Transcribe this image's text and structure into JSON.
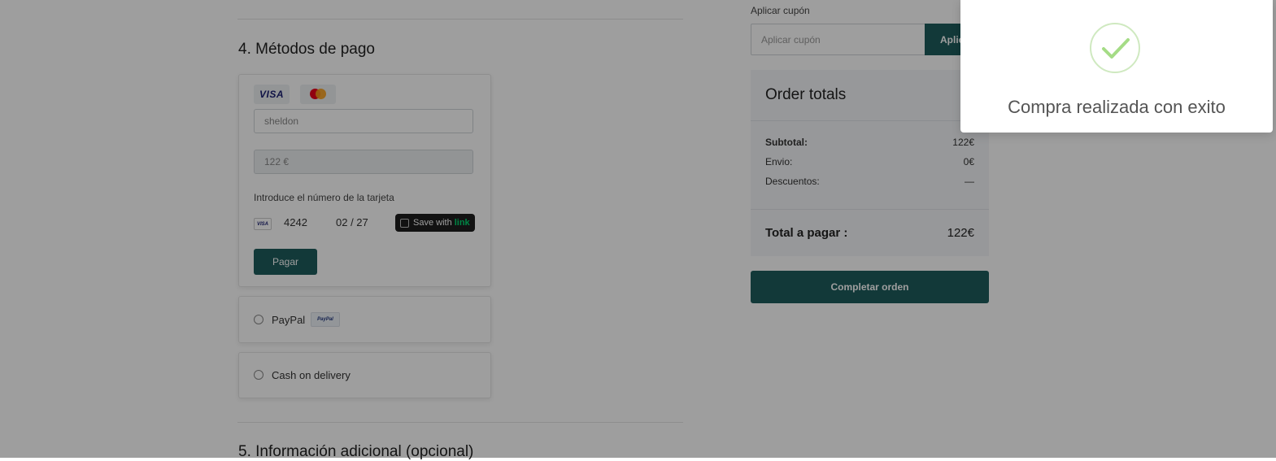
{
  "colors": {
    "accent": "#1e5c5c",
    "success": "#a5dc86",
    "link": "#00d66f",
    "overlay": "rgba(0,0,0,0.38)"
  },
  "payment": {
    "section_title": "4. Métodos de pago",
    "card_brands": [
      "visa-icon",
      "mastercard-icon"
    ],
    "visa_text": "VISA",
    "name_value": "sheldon",
    "amount_value": "122 €",
    "card_hint": "Introduce el número de la tarjeta",
    "mini_visa": "VISA",
    "card_last4": "4242",
    "card_expiry": "02 / 27",
    "link_label": "Save with",
    "link_word": "link",
    "pay_label": "Pagar",
    "paypal_label": "PayPal",
    "paypal_badge": "PayPal",
    "cod_label": "Cash on delivery"
  },
  "additional": {
    "section_title": "5. Información adicional (opcional)"
  },
  "coupon": {
    "label": "Aplicar cupón",
    "placeholder": "Aplicar cupón",
    "button_label": "Aplicar"
  },
  "totals": {
    "title": "Order totals",
    "subtotal_label": "Subtotal:",
    "subtotal_value": "122€",
    "shipping_label": "Envio:",
    "shipping_value": "0€",
    "discount_label": "Descuentos:",
    "discount_value": "—",
    "grand_label": "Total a pagar :",
    "grand_value": "122€"
  },
  "complete_order_label": "Completar orden",
  "toast": {
    "icon": "success-check-icon",
    "message": "Compra realizada con exito"
  }
}
